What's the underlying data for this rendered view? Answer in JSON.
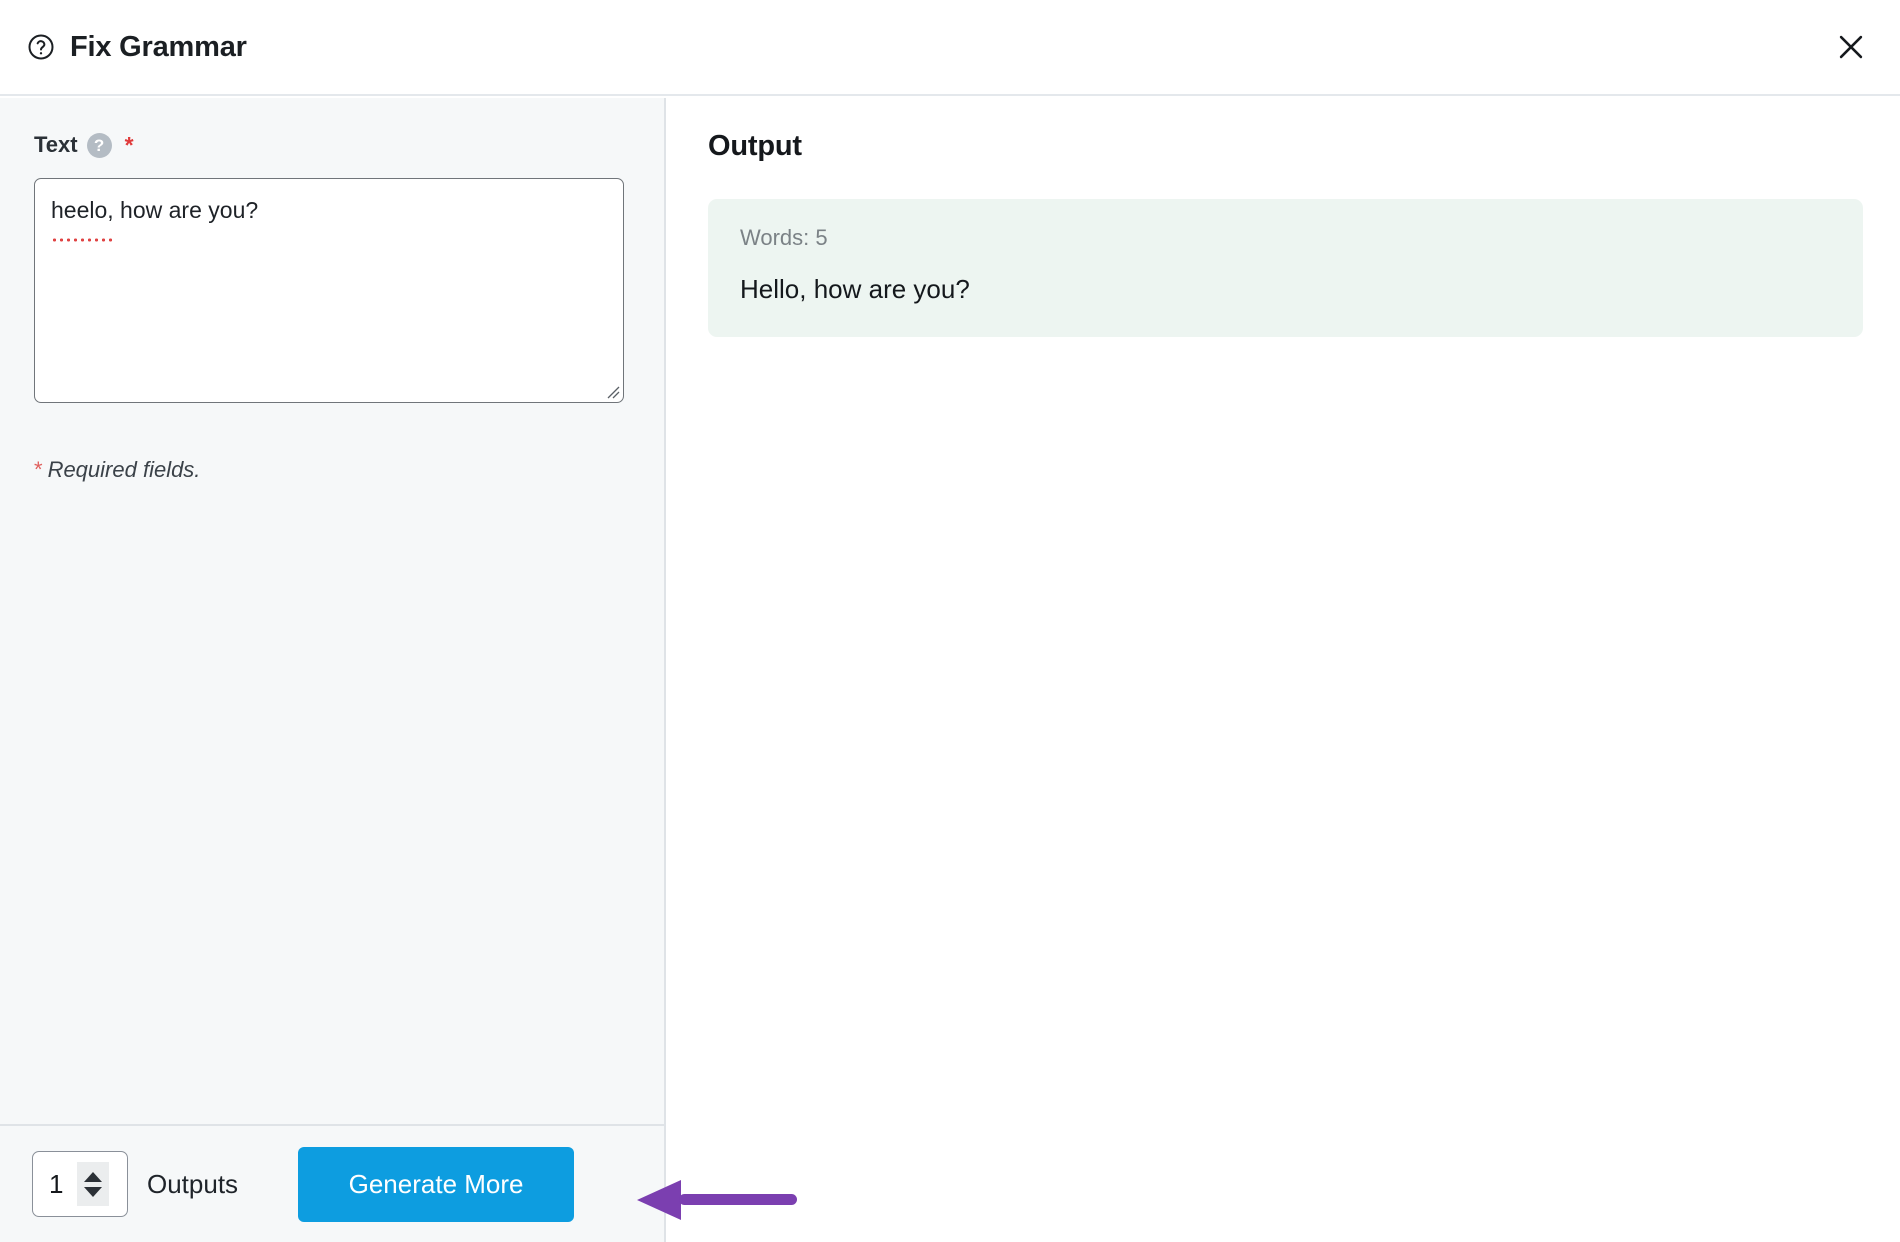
{
  "header": {
    "help_icon": "question-circle-icon",
    "title": "Fix Grammar",
    "close_icon": "close-icon"
  },
  "form": {
    "field_label": "Text",
    "help_badge": "?",
    "required_marker": "*",
    "text_value": "heelo, how are you?",
    "text_placeholder": "",
    "required_note_star": "*",
    "required_note": "Required fields."
  },
  "bottom_bar": {
    "outputs_value": "1",
    "outputs_label": "Outputs",
    "generate_label": "Generate More"
  },
  "output": {
    "title": "Output",
    "words_label": "Words: 5",
    "result_text": "Hello, how are you?"
  },
  "annotation": {
    "arrow_color": "#7b3fb0",
    "points_to": "generate-more-button"
  },
  "colors": {
    "accent_blue": "#0d9de0",
    "panel_bg": "#f6f8f9",
    "card_bg": "#edf5f1",
    "required_red": "#e03b3b",
    "divider": "#dfe3e7"
  }
}
